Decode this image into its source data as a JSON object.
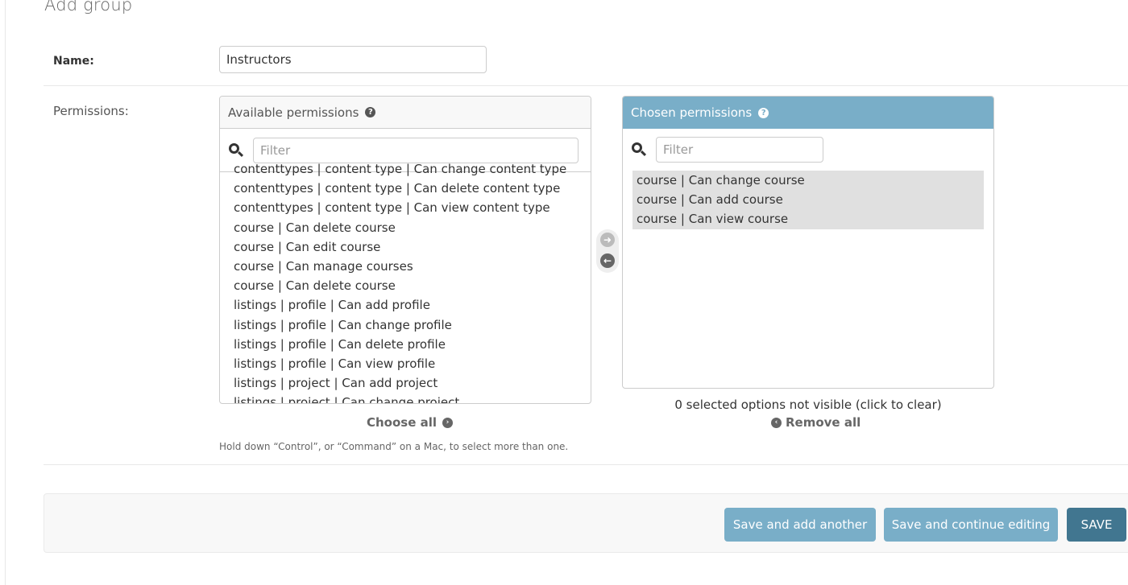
{
  "page": {
    "title": "Add group"
  },
  "name_field": {
    "label": "Name:",
    "value": "Instructors"
  },
  "permissions": {
    "label": "Permissions:",
    "available": {
      "title": "Available permissions",
      "help_icon": "question-circle-icon",
      "filter_placeholder": "Filter",
      "options": [
        "contenttypes | content type | Can change content type",
        "contenttypes | content type | Can delete content type",
        "contenttypes | content type | Can view content type",
        "course | Can delete course",
        "course | Can edit course",
        "course | Can manage courses",
        "course | Can delete course",
        "listings | profile | Can add profile",
        "listings | profile | Can change profile",
        "listings | profile | Can delete profile",
        "listings | profile | Can view profile",
        "listings | project | Can add project",
        "listings | project | Can change project"
      ],
      "choose_all_label": "Choose all"
    },
    "chosen": {
      "title": "Chosen permissions",
      "help_icon": "question-circle-icon",
      "filter_placeholder": "Filter",
      "options": [
        "course | Can change course",
        "course | Can add course",
        "course | Can view course"
      ],
      "hidden_notice": "0 selected options not visible (click to clear)",
      "remove_all_label": "Remove all"
    },
    "help_text": "Hold down “Control”, or “Command” on a Mac, to select more than one."
  },
  "actions": {
    "save_add_another": "Save and add another",
    "save_continue": "Save and continue editing",
    "save": "Save"
  },
  "colors": {
    "chosen_header": "#79aec8",
    "primary_button": "#417690",
    "secondary_button": "#79aec8"
  }
}
